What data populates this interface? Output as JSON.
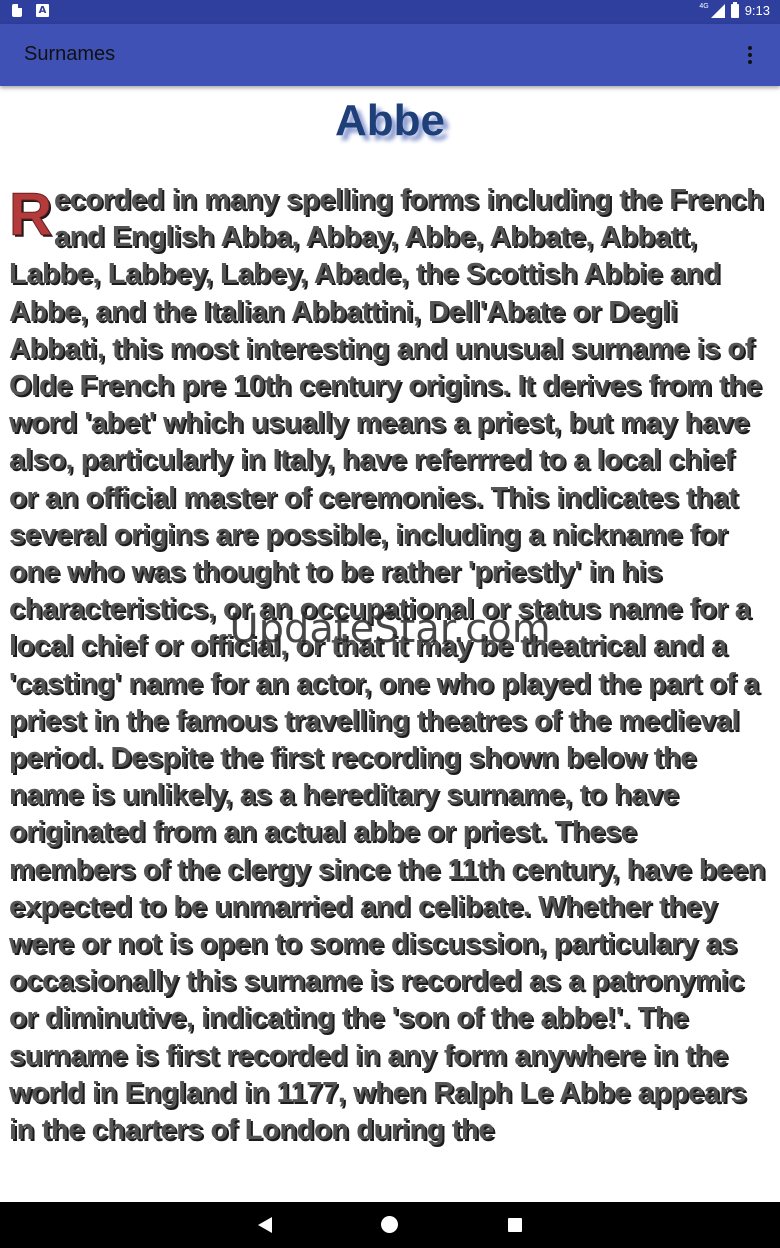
{
  "status_bar": {
    "network": "4G",
    "time": "9:13"
  },
  "app_bar": {
    "title": "Surnames"
  },
  "surname": {
    "heading": "Abbe",
    "dropcap": "R",
    "body": "ecorded in many spelling forms including the French and English Abba, Abbay, Abbe, Abbate, Abbatt, Labbe, Labbey, Labey, Abade, the Scottish Abbie and Abbe, and the Italian Abbattini, Dell'Abate or Degli Abbati, this most interesting and unusual surname is of Olde French pre 10th century origins. It derives from the word 'abet' which usually means a priest, but may have also, particularly in Italy, have referrred to a local chief or an official master of ceremonies. This indicates that several origins are possible, including a nickname for one who was thought to be rather 'priestly' in his characteristics, or an occupational or status name for a local chief or official, or that it may be theatrical and a 'casting' name for an actor, one who played the part of a priest in the famous travelling theatres of the medieval period. Despite the first recording shown below the name is unlikely, as a hereditary surname, to have originated from an actual abbe or priest. These members of the clergy since the 11th century, have been expected to be unmarried and celibate. Whether they were or not is open to some discussion, particulary as occasionally this surname is recorded as a patronymic or diminutive, indicating the 'son of the abbe!'. The surname is first recorded in any form anywhere in the world in England in 1177, when Ralph Le Abbe appears in the charters of London during the"
  },
  "watermark": "UpdateStar.com",
  "icons": {
    "status_left": [
      "sd-card-icon",
      "a-notification-icon"
    ],
    "status_right": [
      "signal-icon",
      "battery-icon"
    ],
    "app_bar": "more-vert-icon",
    "nav": [
      "back-icon",
      "home-icon",
      "recents-icon"
    ]
  },
  "colors": {
    "status_bar": "#2f3f9e",
    "app_bar": "#3f51b5",
    "heading": "#1e3f78",
    "dropcap": "#b33b3b",
    "body_text": "#555555"
  }
}
